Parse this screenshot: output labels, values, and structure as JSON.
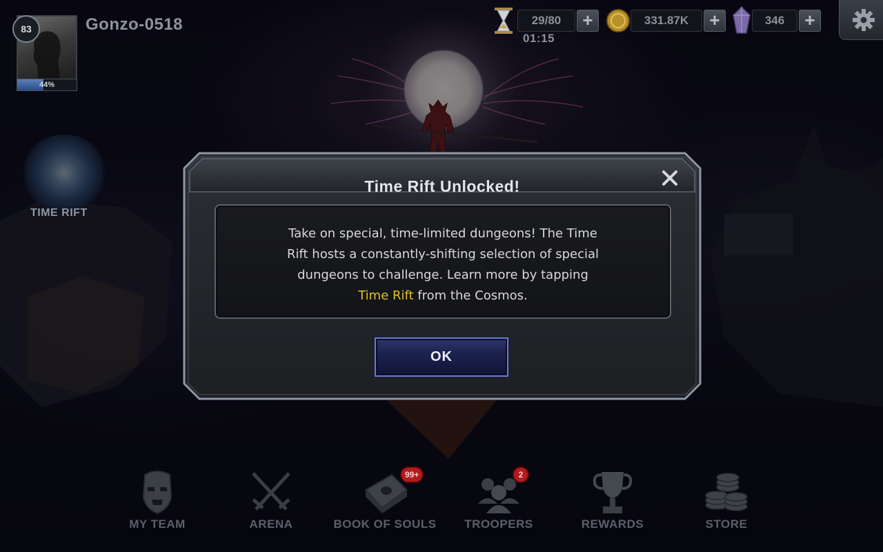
{
  "player": {
    "level": "83",
    "name": "Gonzo-0518",
    "xp_percent_label": "44%",
    "xp_fraction": 0.44
  },
  "resources": {
    "energy": "29/80",
    "energy_timer": "01:15",
    "gold": "331.87K",
    "crystals": "346"
  },
  "map": {
    "time_rift_label": "TIME RIFT"
  },
  "modal": {
    "title": "Time Rift Unlocked!",
    "body_lines": [
      "Take on special, time-limited dungeons! The Time",
      "Rift hosts a constantly-shifting selection of special",
      "dungeons to challenge. Learn more by tapping"
    ],
    "body_highlight": "Time Rift",
    "body_tail": " from the Cosmos.",
    "ok_label": "OK",
    "highlight_color": "#e1c02a"
  },
  "nav": {
    "my_team": "MY TEAM",
    "arena": "ARENA",
    "book_of_souls": "BOOK OF SOULS",
    "book_of_souls_badge": "99+",
    "troopers": "TROOPERS",
    "troopers_badge": "2",
    "rewards": "REWARDS",
    "store": "STORE"
  }
}
